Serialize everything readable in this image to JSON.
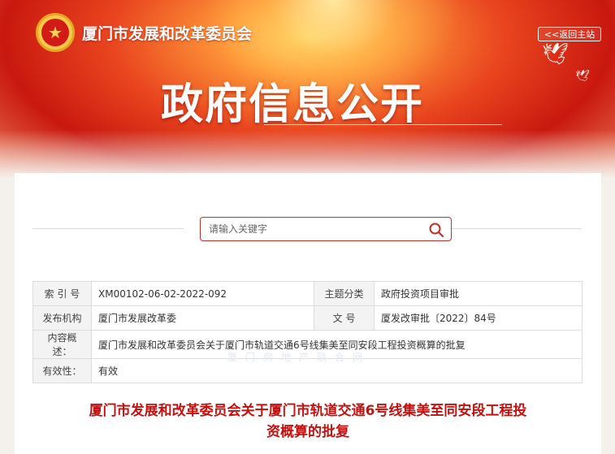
{
  "header": {
    "org_name": "厦门市发展和改革委员会",
    "back_label": "<<返回主站",
    "main_title": "政府信息公开"
  },
  "search": {
    "placeholder": "请输入关键字"
  },
  "info": {
    "index_label": "索 引 号",
    "index_value": "XM00102-06-02-2022-092",
    "category_label": "主题分类",
    "category_value": "政府投资项目审批",
    "publisher_label": "发布机构",
    "publisher_value": "厦门市发展改革委",
    "docno_label": "文    号",
    "docno_value": "厦发改审批〔2022〕84号",
    "summary_label": "内容概述：",
    "summary_value": "厦门市发展和改革委员会关于厦门市轨道交通6号线集美至同安段工程投资概算的批复",
    "validity_label": "有效性：",
    "validity_value": "有效"
  },
  "watermark": "厦门房地产联合网",
  "document": {
    "title_line1": "厦门市发展和改革委员会关于厦门市轨道交通6号线集美至同安段工程投",
    "title_line2": "资概算的批复"
  },
  "colors": {
    "accent_red": "#c3110f",
    "header_red": "#d8301c"
  },
  "icons": {
    "emblem": "national-emblem-icon",
    "search": "search-icon",
    "dove": "dove-icon"
  }
}
